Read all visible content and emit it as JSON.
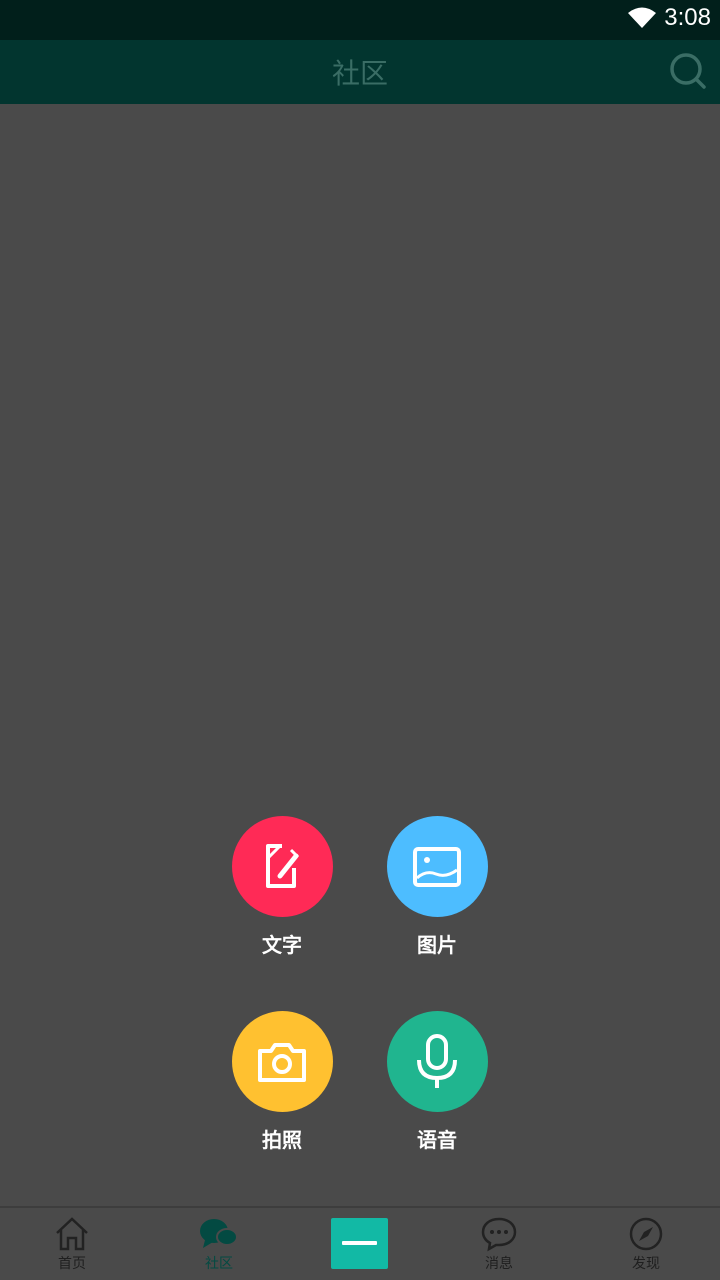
{
  "status_bar": {
    "time": "3:08"
  },
  "header": {
    "title": "社区"
  },
  "actions": [
    {
      "label": "文字",
      "icon": "edit-icon",
      "color": "#ff2a56"
    },
    {
      "label": "图片",
      "icon": "image-icon",
      "color": "#4dbdff"
    },
    {
      "label": "拍照",
      "icon": "camera-icon",
      "color": "#ffc130"
    },
    {
      "label": "语音",
      "icon": "microphone-icon",
      "color": "#20b58f"
    }
  ],
  "bottom_nav": {
    "items": [
      {
        "label": "首页",
        "icon": "home-icon"
      },
      {
        "label": "社区",
        "icon": "chat-bubbles-icon",
        "active": true
      },
      {
        "label": "",
        "icon": "minus-icon"
      },
      {
        "label": "消息",
        "icon": "message-icon"
      },
      {
        "label": "发现",
        "icon": "compass-icon"
      }
    ]
  },
  "colors": {
    "header": "#02352f",
    "status_bar": "#011f1b",
    "overlay": "#4a4a4a",
    "accent": "#12b9a5"
  }
}
